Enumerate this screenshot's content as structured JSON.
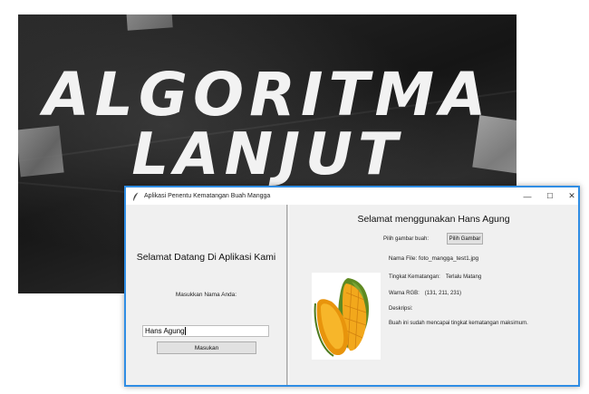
{
  "poster": {
    "line1": "ALGORITMA",
    "line2": "LANJUT"
  },
  "window": {
    "title": "Aplikasi Penentu Kematangan Buah Mangga",
    "controls": {
      "minimize": "—",
      "maximize": "☐",
      "close": "✕"
    }
  },
  "left": {
    "welcome": "Selamat Datang Di Aplikasi Kami",
    "name_label": "Masukkan Nama Anda:",
    "name_value": "Hans Agung",
    "submit_label": "Masukan"
  },
  "right": {
    "welcome": "Selamat menggunakan Hans Agung",
    "choose_label": "Pilih gambar buah:",
    "choose_button": "Pilih Gambar",
    "filename": "Nama File: foto_mangga_test1.jpg",
    "ripeness_label": "Tingkat Kematangan:",
    "ripeness_value": "Terlalu Matang",
    "rgb_label": "Warna RGB:",
    "rgb_value": "(131, 211, 231)",
    "desc_label": "Deskripsi:",
    "desc_text": "Buah ini sudah mencapai tingkat kematangan maksimum."
  },
  "colors": {
    "accent": "#2f8de4",
    "mango_skin": "#6f9a2a",
    "mango_flesh": "#f2a81c"
  },
  "icons": {
    "app": "feather-icon",
    "minimize": "minimize-icon",
    "maximize": "maximize-icon",
    "close": "close-icon"
  }
}
